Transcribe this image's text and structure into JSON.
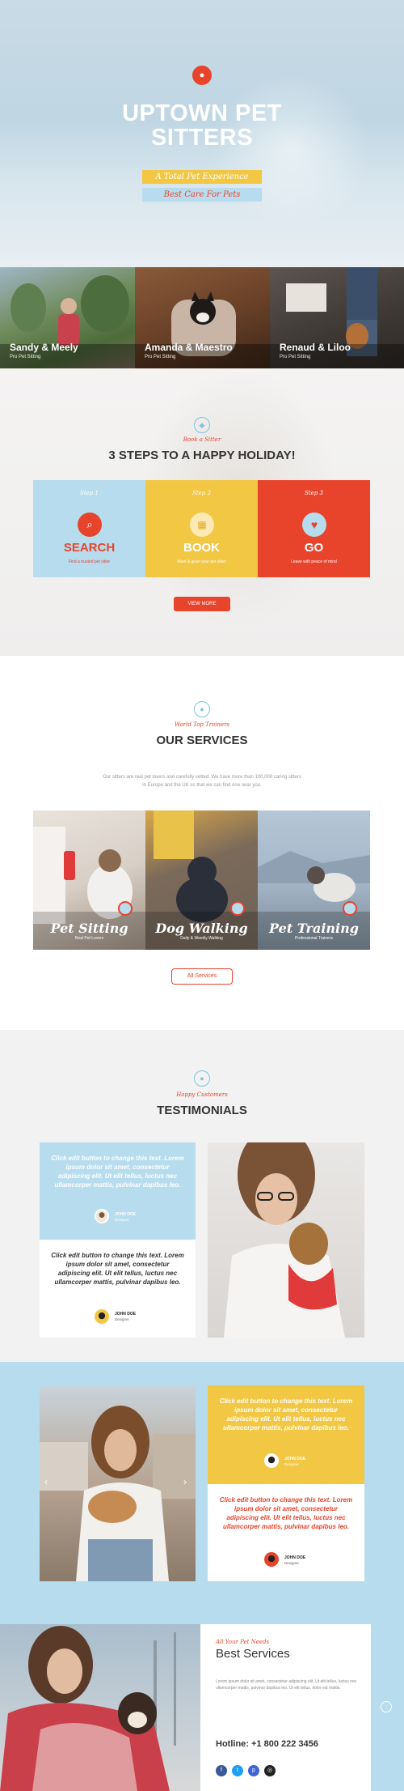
{
  "hero": {
    "title_line1": "UPTOWN PET",
    "title_line2": "SITTERS",
    "tag1": "A Total Pet Experience",
    "tag2": "Best Care For Pets"
  },
  "pets": [
    {
      "name": "Sandy & Meely",
      "sub": "Pro Pet Sitting"
    },
    {
      "name": "Amanda & Maestro",
      "sub": "Pro Pet Sitting"
    },
    {
      "name": "Renaud & Liloo",
      "sub": "Pro Pet Sitting"
    }
  ],
  "steps_section": {
    "script": "Book a Sitter",
    "title": "3 STEPS TO A HAPPY HOLIDAY!",
    "steps": [
      {
        "label": "Step 1",
        "title": "SEARCH",
        "desc": "Find a trusted pet sitter"
      },
      {
        "label": "Step 2",
        "title": "BOOK",
        "desc": "Meet & greet your pet sitter"
      },
      {
        "label": "Step 3",
        "title": "GO",
        "desc": "Leave with peace of mind"
      }
    ],
    "button": "VIEW MORE"
  },
  "services": {
    "script": "World Top Trainers",
    "title": "OUR SERVICES",
    "intro": "Our sitters are real pet lovers and carefully vetted. We have more than 100,000 caring sitters in Europe and the UK so that we can find one near you.",
    "items": [
      {
        "title": "Pet Sitting",
        "sub": "Real Pet Lovers"
      },
      {
        "title": "Dog Walking",
        "sub": "Daily & Weekly Walking"
      },
      {
        "title": "Pet Training",
        "sub": "Professional Trainers"
      }
    ],
    "button": "All Services"
  },
  "testimonials": {
    "script": "Happy Customers",
    "title": "TESTIMONIALS",
    "quote": "Click edit button to change this text. Lorem ipsum dolor sit amet, consectetur adipiscing elit. Ut elit tellus, luctus nec ullamcorper mattis, pulvinar dapibus leo.",
    "name": "JOHN DOE",
    "role": "Designer"
  },
  "contact": {
    "script": "All Your Pet Needs",
    "title": "Best Services",
    "text": "Lorem ipsum dolor sit amet, consectetur adipiscing elit. Ut elit tellus, luctus nec ullamcorper mattis, pulvinar dapibus leo. Ut elit tellus, dolor est mattis.",
    "hotline": "Hotline: +1 800 222 3456"
  },
  "colors": {
    "red": "#e8442c",
    "yellow": "#f2c744",
    "blue": "#b7dcee"
  }
}
